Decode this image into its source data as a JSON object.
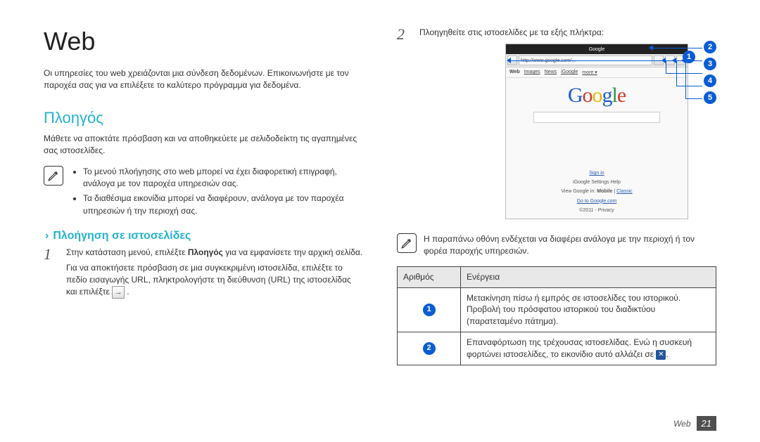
{
  "page": {
    "title": "Web",
    "intro": "Οι υπηρεσίες του web χρειάζονται μια σύνδεση δεδομένων. Επικοινωνήστε με τον παροχέα σας για να επιλέξετε το καλύτερο πρόγραμμα για δεδομένα.",
    "section_title": "Πλοηγός",
    "section_desc": "Μάθετε να αποκτάτε πρόσβαση και να αποθηκεύετε με σελιδοδείκτη τις αγαπημένες σας ιστοσελίδες.",
    "notes_left": [
      "Το μενού πλοήγησης στο web μπορεί να έχει διαφορετική επιγραφή, ανάλογα με τον παροχέα υπηρεσιών σας.",
      "Τα διαθέσιμα εικονίδια μπορεί να διαφέρουν, ανάλογα με τον παροχέα υπηρεσιών ή την περιοχή σας."
    ],
    "sub_title": "Πλοήγηση σε ιστοσελίδες",
    "step1_num": "1",
    "step1_a": "Στην κατάσταση μενού, επιλέξτε ",
    "step1_bold": "Πλοηγός",
    "step1_b": " για να εμφανίσετε την αρχική σελίδα.",
    "step1_para": "Για να αποκτήσετε πρόσβαση σε μια συγκεκριμένη ιστοσελίδα, επιλέξτε το πεδίο εισαγωγής URL, πληκτρολογήστε τη διεύθυνση (URL) της ιστοσελίδας και επιλέξτε ",
    "go_glyph": "→",
    "step1_period": ".",
    "step2_num": "2",
    "step2_text": "Πλοηγηθείτε στις ιστοσελίδες με τα εξής πλήκτρα:",
    "note_right": "Η παραπάνω οθόνη ενδέχεται να διαφέρει ανάλογα με την περιοχή ή τον φορέα παροχής υπηρεσιών.",
    "table": {
      "col1": "Αριθμός",
      "col2": "Ενέργεια",
      "row1": "Μετακίνηση πίσω ή εμπρός σε ιστοσελίδες του ιστορικού. Προβολή του πρόσφατου ιστορικού του διαδικτύου (παρατεταμένο πάτημα).",
      "row2_a": "Επαναφόρτωση της τρέχουσας ιστοσελίδας. Ενώ η συσκευή φορτώνει ιστοσελίδες, το εικονίδιο αυτό αλλάζει σε ",
      "row2_b": "."
    },
    "footer_label": "Web",
    "footer_page": "21"
  },
  "callouts": [
    "2",
    "1",
    "3",
    "4",
    "5"
  ],
  "phone": {
    "status": "Google",
    "url": "http://www.google.com/...",
    "tabs": [
      "Web",
      "Images",
      "News",
      "iGoogle",
      "more ▾"
    ],
    "foot_signin": "Sign in",
    "foot_settings": "iGoogle   Settings   Help",
    "foot_mobile_a": "View Google in: ",
    "foot_mobile_b": "Mobile",
    "foot_mobile_c": " | ",
    "foot_mobile_d": "Classic",
    "foot_goto": "Go to Google.com",
    "foot_priv": "©2011 - Privacy"
  }
}
